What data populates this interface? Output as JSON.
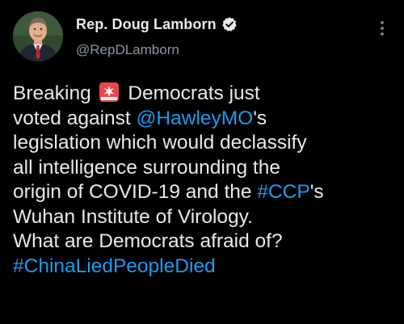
{
  "author": {
    "display_name": "Rep. Doug Lamborn",
    "handle": "@RepDLamborn",
    "verified_icon": "verified-badge-icon"
  },
  "tweet": {
    "t1": "Breaking ",
    "siren_icon": "rotating-light-emoji",
    "t2": " Democrats just\nvoted against ",
    "mention": "@HawleyMO",
    "t3": "'s\nlegislation which would declassify\nall intelligence surrounding the\norigin of COVID-19 and the ",
    "hashtag1": "#CCP",
    "t4": "'s\nWuhan Institute of Virology.\nWhat are Democrats afraid of?\n",
    "hashtag2": "#ChinaLiedPeopleDied"
  },
  "colors": {
    "background": "#000000",
    "text": "#e7e9ea",
    "secondary": "#8b98a5",
    "link": "#1d9bf0"
  }
}
